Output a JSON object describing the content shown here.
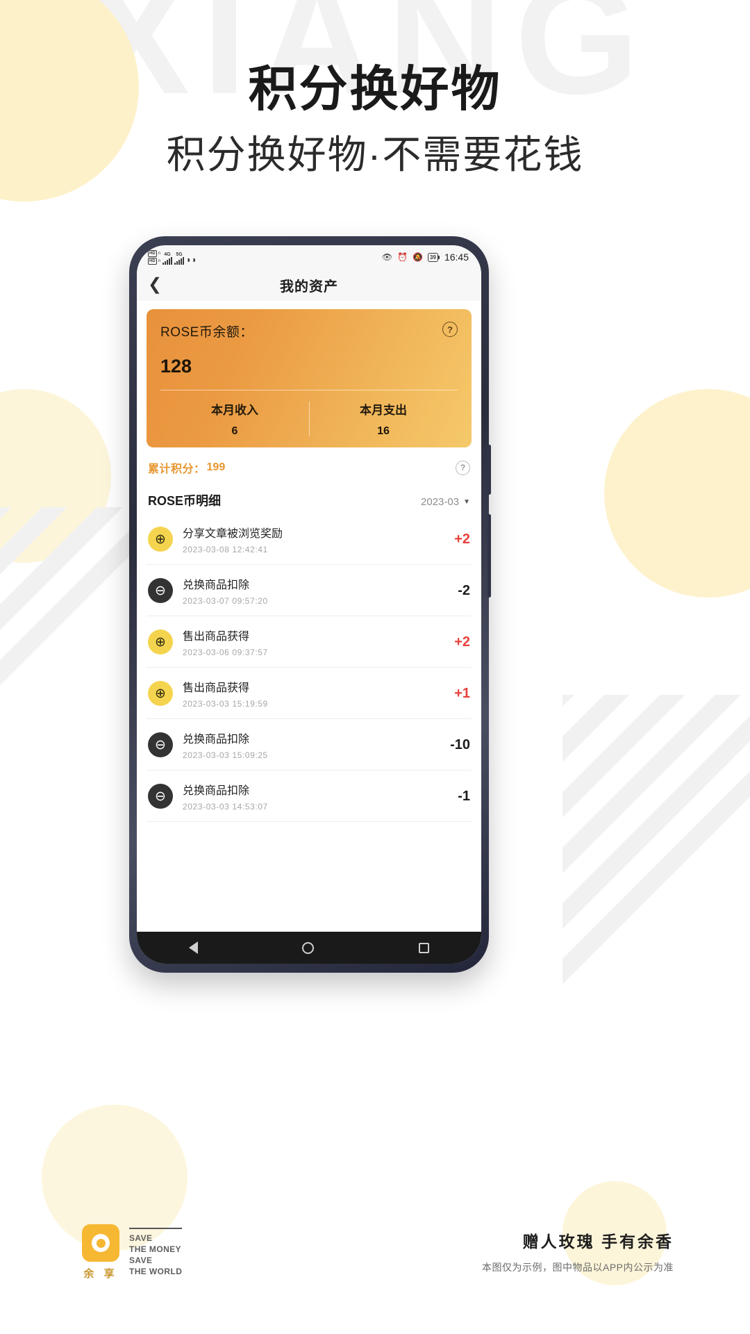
{
  "poster": {
    "watermark": "XIANG",
    "title": "积分换好物",
    "subtitle": "积分换好物·不需要花钱"
  },
  "phone": {
    "statusbar": {
      "hd1": "HD",
      "hd1_sub": "n",
      "hd2": "HD",
      "hd2_sub": "n",
      "net1": "4G",
      "net2": "5G",
      "wifi_icon": "wifi-icon",
      "eye_icon": "eye-icon",
      "alarm_icon": "alarm-icon",
      "mute_icon": "bell-off-icon",
      "battery": "39",
      "time": "16:45"
    },
    "navbar": {
      "back_icon": "chevron-left-icon",
      "title": "我的资产"
    },
    "balance_card": {
      "label": "ROSE币余额：",
      "amount": "128",
      "help_icon": "?",
      "income_label": "本月收入",
      "income_value": "6",
      "expense_label": "本月支出",
      "expense_value": "16"
    },
    "points": {
      "label": "累计积分：",
      "value": "199",
      "help_icon": "?"
    },
    "detail": {
      "title": "ROSE币明细",
      "month": "2023-03",
      "caret_icon": "chevron-down-icon"
    },
    "transactions": [
      {
        "icon": "plus-circle-icon",
        "type": "plus",
        "title": "分享文章被浏览奖励",
        "date": "2023-03-08 12:42:41",
        "amount": "+2",
        "sign": "pos"
      },
      {
        "icon": "minus-circle-icon",
        "type": "minus",
        "title": "兑换商品扣除",
        "date": "2023-03-07 09:57:20",
        "amount": "-2",
        "sign": "neg"
      },
      {
        "icon": "plus-circle-icon",
        "type": "plus",
        "title": "售出商品获得",
        "date": "2023-03-06 09:37:57",
        "amount": "+2",
        "sign": "pos"
      },
      {
        "icon": "plus-circle-icon",
        "type": "plus",
        "title": "售出商品获得",
        "date": "2023-03-03 15:19:59",
        "amount": "+1",
        "sign": "pos"
      },
      {
        "icon": "minus-circle-icon",
        "type": "minus",
        "title": "兑换商品扣除",
        "date": "2023-03-03 15:09:25",
        "amount": "-10",
        "sign": "neg"
      },
      {
        "icon": "minus-circle-icon",
        "type": "minus",
        "title": "兑换商品扣除",
        "date": "2023-03-03 14:53:07",
        "amount": "-1",
        "sign": "neg"
      }
    ],
    "androidbar": {
      "back_icon": "triangle-back-icon",
      "home_icon": "circle-home-icon",
      "recents_icon": "square-recents-icon"
    }
  },
  "footer": {
    "brand_cn": "余 享",
    "brand_en_line1": "SAVE",
    "brand_en_line2": "THE MONEY",
    "brand_en_line3": "SAVE",
    "brand_en_line4": "THE WORLD",
    "slogan": "赠人玫瑰  手有余香",
    "disclaimer": "本图仅为示例，图中物品以APP内公示为准"
  },
  "colors": {
    "accent_orange": "#e8962f",
    "card_gradient_start": "#e8913c",
    "card_gradient_end": "#f5c96a",
    "positive": "#e8413c",
    "brand_yellow": "#f6b733"
  }
}
